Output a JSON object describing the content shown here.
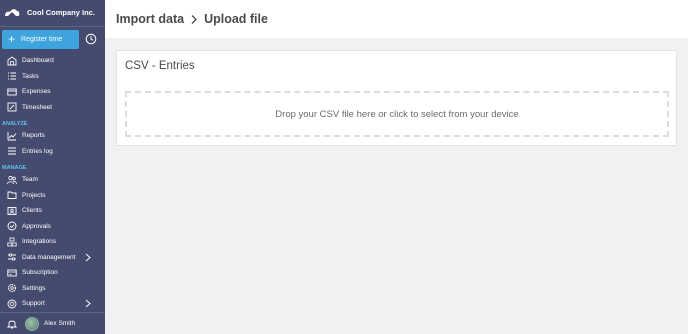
{
  "sidebar": {
    "brand": "Cool Company Inc.",
    "register_label": "Register time",
    "sections": {
      "analyze": "ANALYZE",
      "manage": "MANAGE"
    },
    "items": [
      {
        "label": "Dashboard",
        "icon": "dashboard-icon"
      },
      {
        "label": "Tasks",
        "icon": "tasks-icon"
      },
      {
        "label": "Expenses",
        "icon": "expenses-icon"
      },
      {
        "label": "Timesheet",
        "icon": "timesheet-icon"
      },
      {
        "label": "Reports",
        "icon": "reports-icon"
      },
      {
        "label": "Entries log",
        "icon": "entries-log-icon"
      },
      {
        "label": "Team",
        "icon": "team-icon"
      },
      {
        "label": "Projects",
        "icon": "projects-icon"
      },
      {
        "label": "Clients",
        "icon": "clients-icon"
      },
      {
        "label": "Approvals",
        "icon": "approvals-icon"
      },
      {
        "label": "Integrations",
        "icon": "integrations-icon"
      },
      {
        "label": "Data management",
        "icon": "data-management-icon",
        "has_submenu": true
      },
      {
        "label": "Subscription",
        "icon": "subscription-icon"
      },
      {
        "label": "Settings",
        "icon": "settings-icon"
      },
      {
        "label": "Support",
        "icon": "support-icon",
        "has_submenu": true
      }
    ],
    "user_name": "Alex Smith"
  },
  "header": {
    "breadcrumb": [
      "Import data",
      "Upload file"
    ]
  },
  "card": {
    "title": "CSV - Entries",
    "dropzone_text": "Drop your CSV file here or click to select from your device"
  },
  "colors": {
    "sidebar_bg": "#454b6e",
    "accent": "#3ea4dd",
    "section_label": "#5ec3f0",
    "page_bg": "#f1f1f3"
  }
}
